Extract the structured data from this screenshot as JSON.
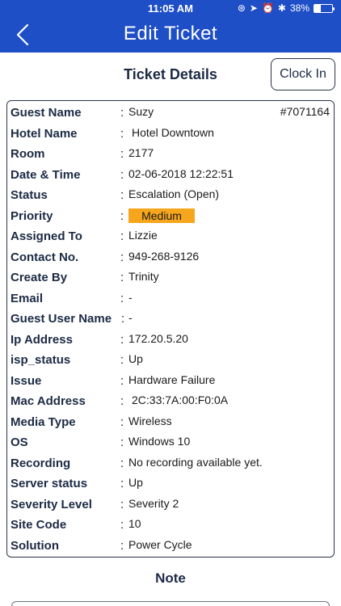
{
  "status_bar": {
    "time": "11:05 AM",
    "battery_percent": "38%",
    "battery_level": 0.38
  },
  "nav": {
    "title": "Edit Ticket",
    "back_icon": "chevron-left-icon"
  },
  "section_title": "Ticket Details",
  "clock_in_label": "Clock In",
  "ticket_number": "#7071164",
  "details": {
    "guest_name": {
      "label": "Guest Name",
      "value": "Suzy"
    },
    "hotel_name": {
      "label": "Hotel Name",
      "value": "Hotel Downtown"
    },
    "room": {
      "label": "Room",
      "value": "2177"
    },
    "date_time": {
      "label": "Date & Time",
      "value": "02-06-2018 12:22:51"
    },
    "status": {
      "label": "Status",
      "value": "Escalation (Open)"
    },
    "priority": {
      "label": "Priority",
      "value": "Medium"
    },
    "assigned_to": {
      "label": "Assigned To",
      "value": "Lizzie"
    },
    "contact_no": {
      "label": "Contact No.",
      "value": "949-268-9126"
    },
    "create_by": {
      "label": "Create By",
      "value": "Trinity"
    },
    "email": {
      "label": "Email",
      "value": "-"
    },
    "guest_user_name": {
      "label": "Guest User Name",
      "value": "-"
    },
    "ip_address": {
      "label": "Ip Address",
      "value": "172.20.5.20"
    },
    "isp_status": {
      "label": "isp_status",
      "value": "Up"
    },
    "issue": {
      "label": "Issue",
      "value": "Hardware Failure"
    },
    "mac_address": {
      "label": "Mac Address",
      "value": "2C:33:7A:00:F0:0A"
    },
    "media_type": {
      "label": "Media Type",
      "value": "Wireless"
    },
    "os": {
      "label": "OS",
      "value": "Windows 10"
    },
    "recording": {
      "label": "Recording",
      "value": "No recording available yet."
    },
    "server_status": {
      "label": "Server status",
      "value": "Up"
    },
    "severity_level": {
      "label": "Severity Level",
      "value": "Severity 2"
    },
    "site_code": {
      "label": "Site Code",
      "value": "10"
    },
    "solution": {
      "label": "Solution",
      "value": "Power Cycle"
    }
  },
  "colon": ":",
  "note_title": "Note",
  "colors": {
    "nav_bg": "#1f4fc7",
    "priority_badge": "#f5a61c",
    "label_text": "#1c2a44"
  }
}
